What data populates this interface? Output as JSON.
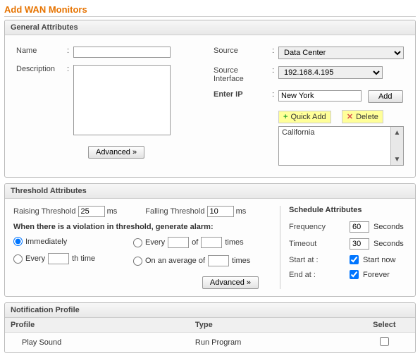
{
  "page": {
    "title": "Add WAN Monitors"
  },
  "general": {
    "header": "General Attributes",
    "name_label": "Name",
    "desc_label": "Description",
    "source_label": "Source",
    "source_value": "Data Center",
    "src_if_label": "Source Interface",
    "src_if_value": "192.168.4.195",
    "enter_ip_label": "Enter IP",
    "enter_ip_value": "New York",
    "add_btn": "Add",
    "quick_add": "Quick Add",
    "delete": "Delete",
    "list_item": "California",
    "advanced": "Advanced »"
  },
  "threshold": {
    "header": "Threshold Attributes",
    "raising_label": "Raising Threshold",
    "raising_value": "25",
    "falling_label": "Falling Threshold",
    "falling_value": "10",
    "ms": "ms",
    "violation": "When there is a violation in threshold, generate alarm:",
    "opt_immediately": "Immediately",
    "opt_every_of_times_a": "Every",
    "opt_every_of_times_b": "of",
    "opt_every_of_times_c": "times",
    "opt_every_th_a": "Every",
    "opt_every_th_b": "th time",
    "opt_avg_a": "On an average of",
    "opt_avg_b": "times",
    "advanced": "Advanced »",
    "schedule": {
      "header": "Schedule Attributes",
      "frequency_label": "Frequency",
      "frequency_value": "60",
      "timeout_label": "Timeout",
      "timeout_value": "30",
      "seconds": "Seconds",
      "start_label": "Start at :",
      "start_now": "Start now",
      "end_label": "End at :",
      "forever": "Forever"
    }
  },
  "notification": {
    "header": "Notification Profile",
    "col_profile": "Profile",
    "col_type": "Type",
    "col_select": "Select",
    "row_profile": "Play Sound",
    "row_type": "Run Program"
  }
}
